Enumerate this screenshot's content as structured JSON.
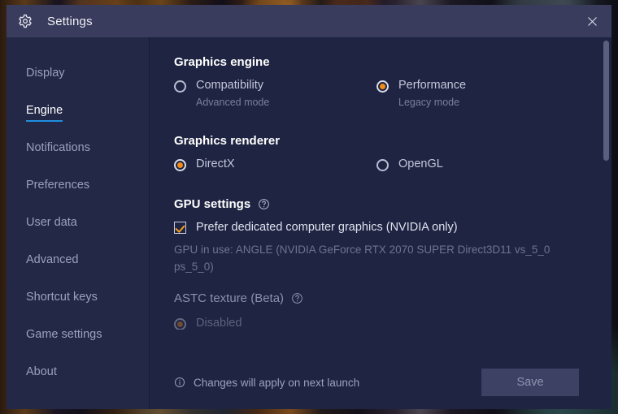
{
  "window": {
    "title": "Settings",
    "gear_icon": "gear-icon",
    "close_icon": "close-icon"
  },
  "sidebar": {
    "items": [
      {
        "label": "Display",
        "active": false
      },
      {
        "label": "Engine",
        "active": true
      },
      {
        "label": "Notifications",
        "active": false
      },
      {
        "label": "Preferences",
        "active": false
      },
      {
        "label": "User data",
        "active": false
      },
      {
        "label": "Advanced",
        "active": false
      },
      {
        "label": "Shortcut keys",
        "active": false
      },
      {
        "label": "Game settings",
        "active": false
      },
      {
        "label": "About",
        "active": false
      }
    ]
  },
  "content": {
    "graphics_engine": {
      "title": "Graphics engine",
      "options": [
        {
          "label": "Compatibility",
          "sublabel": "Advanced mode",
          "selected": false
        },
        {
          "label": "Performance",
          "sublabel": "Legacy mode",
          "selected": true
        }
      ]
    },
    "graphics_renderer": {
      "title": "Graphics renderer",
      "options": [
        {
          "label": "DirectX",
          "selected": true
        },
        {
          "label": "OpenGL",
          "selected": false
        }
      ]
    },
    "gpu_settings": {
      "title": "GPU settings",
      "help_icon": "help-circle-icon",
      "checkbox": {
        "label": "Prefer dedicated computer graphics (NVIDIA only)",
        "checked": true
      },
      "gpu_in_use": "GPU in use: ANGLE (NVIDIA GeForce RTX 2070 SUPER Direct3D11 vs_5_0 ps_5_0)"
    },
    "astc_texture": {
      "title": "ASTC texture (Beta)",
      "help_icon": "help-circle-icon",
      "options": [
        {
          "label": "Disabled",
          "selected": true
        }
      ]
    }
  },
  "footer": {
    "info_icon": "info-circle-icon",
    "note": "Changes will apply on next launch",
    "save_label": "Save"
  },
  "colors": {
    "accent_orange": "#f28c16",
    "accent_blue": "#1f8fe0",
    "titlebar": "#3a3c5e",
    "sidebar": "#232846",
    "content_bg": "#1f2442",
    "scroll_thumb": "#5a5f80",
    "save_button_bg": "#3d4164"
  },
  "scrollbar": {
    "thumb_name": "scrollbar-thumb"
  }
}
